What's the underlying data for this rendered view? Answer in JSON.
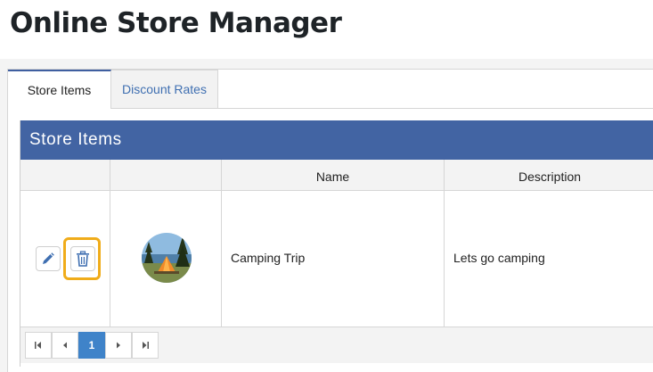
{
  "app": {
    "title": "Online Store Manager"
  },
  "tabs": [
    {
      "label": "Store Items",
      "active": true
    },
    {
      "label": "Discount Rates",
      "active": false
    }
  ],
  "grid": {
    "title": "Store Items",
    "columns": [
      "",
      "",
      "Name",
      "Description"
    ],
    "rows": [
      {
        "name": "Camping Trip",
        "description": "Lets go camping",
        "image_icon": "camping-tent-photo"
      }
    ]
  },
  "actions": {
    "edit_icon": "pencil-icon",
    "delete_icon": "trash-icon"
  },
  "pager": {
    "current_page": "1",
    "first_icon": "first-page-icon",
    "prev_icon": "prev-page-icon",
    "next_icon": "next-page-icon",
    "last_icon": "last-page-icon"
  },
  "colors": {
    "header_bar": "#4264a3",
    "highlight": "#f0ac1a",
    "active_page": "#3f83c9"
  }
}
